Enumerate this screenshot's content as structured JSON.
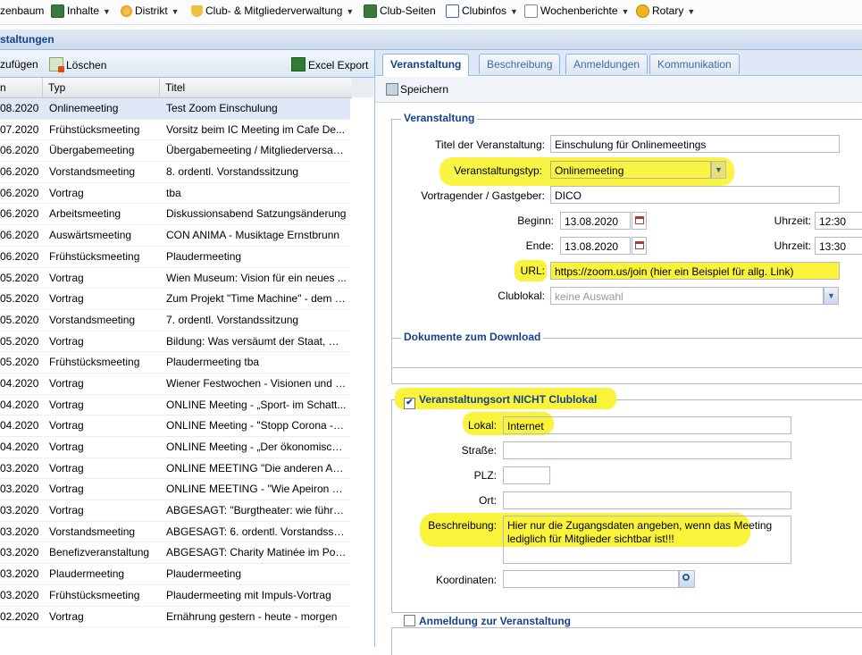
{
  "menubar": {
    "items": [
      {
        "label": "zenbaum",
        "icon": "",
        "has_arrow": false
      },
      {
        "label": "Inhalte",
        "icon": "table-icon",
        "has_arrow": true
      },
      {
        "label": "Distrikt",
        "icon": "flower-icon",
        "has_arrow": true
      },
      {
        "label": "Club- & Mitgliederverwaltung",
        "icon": "shield-icon",
        "has_arrow": true
      },
      {
        "label": "Club-Seiten",
        "icon": "table-icon",
        "has_arrow": false
      },
      {
        "label": "Clubinfos",
        "icon": "table-icon",
        "has_arrow": true
      },
      {
        "label": "Wochenberichte",
        "icon": "document-icon",
        "has_arrow": true
      },
      {
        "label": "Rotary",
        "icon": "rotary-wheel-icon",
        "has_arrow": true
      }
    ]
  },
  "panel_title": "staltungen",
  "list": {
    "toolbar": {
      "add": "zufügen",
      "delete": "Löschen",
      "export": "Excel Export"
    },
    "columns": [
      "n",
      "Typ",
      "Titel"
    ],
    "rows": [
      {
        "date": "08.2020",
        "type": "Onlinemeeting",
        "title": "Test Zoom Einschulung",
        "selected": true
      },
      {
        "date": "07.2020",
        "type": "Frühstücksmeeting",
        "title": "Vorsitz beim IC Meeting im Cafe De..."
      },
      {
        "date": "06.2020",
        "type": "Übergabemeeting",
        "title": "Übergabemeeting / Mitgliederversam..."
      },
      {
        "date": "06.2020",
        "type": "Vorstandsmeeting",
        "title": "8. ordentl. Vorstandssitzung"
      },
      {
        "date": "06.2020",
        "type": "Vortrag",
        "title": "tba"
      },
      {
        "date": "06.2020",
        "type": "Arbeitsmeeting",
        "title": "Diskussionsabend Satzungsänderung"
      },
      {
        "date": "06.2020",
        "type": "Auswärtsmeeting",
        "title": "CON ANIMA - Musiktage Ernstbrunn"
      },
      {
        "date": "06.2020",
        "type": "Frühstücksmeeting",
        "title": "Plaudermeeting"
      },
      {
        "date": "05.2020",
        "type": "Vortrag",
        "title": "Wien Museum: Vision für ein neues ..."
      },
      {
        "date": "05.2020",
        "type": "Vortrag",
        "title": "Zum Projekt \"Time Machine\" - dem g..."
      },
      {
        "date": "05.2020",
        "type": "Vorstandsmeeting",
        "title": "7. ordentl. Vorstandssitzung"
      },
      {
        "date": "05.2020",
        "type": "Vortrag",
        "title": "Bildung: Was versäumt der Staat, wa..."
      },
      {
        "date": "05.2020",
        "type": "Frühstücksmeeting",
        "title": "Plaudermeeting tba"
      },
      {
        "date": "04.2020",
        "type": "Vortrag",
        "title": "Wiener Festwochen - Visionen und I..."
      },
      {
        "date": "04.2020",
        "type": "Vortrag",
        "title": "ONLINE Meeting - „Sport- im Schatt..."
      },
      {
        "date": "04.2020",
        "type": "Vortrag",
        "title": "ONLINE Meeting - \"Stopp Corona - d..."
      },
      {
        "date": "04.2020",
        "type": "Vortrag",
        "title": "ONLINE Meeting - „Der ökonomisch..."
      },
      {
        "date": "03.2020",
        "type": "Vortrag",
        "title": "ONLINE MEETING \"Die anderen Au..."
      },
      {
        "date": "03.2020",
        "type": "Vortrag",
        "title": "ONLINE MEETING - \"Wie Apeiron Bi..."
      },
      {
        "date": "03.2020",
        "type": "Vortrag",
        "title": "ABGESAGT: \"Burgtheater: wie führt ..."
      },
      {
        "date": "03.2020",
        "type": "Vorstandsmeeting",
        "title": "ABGESAGT: 6. ordentl. Vorstandssit..."
      },
      {
        "date": "03.2020",
        "type": "Benefizveranstaltung",
        "title": "ABGESAGT: Charity Matinée im Por..."
      },
      {
        "date": "03.2020",
        "type": "Plaudermeeting",
        "title": "Plaudermeeting"
      },
      {
        "date": "03.2020",
        "type": "Frühstücksmeeting",
        "title": "Plaudermeeting mit Impuls-Vortrag"
      },
      {
        "date": "02.2020",
        "type": "Vortrag",
        "title": "Ernährung gestern - heute - morgen"
      }
    ]
  },
  "detail": {
    "tabs": [
      "Veranstaltung",
      "Beschreibung",
      "Anmeldungen",
      "Kommunikation"
    ],
    "save": "Speichern",
    "event": {
      "legend": "Veranstaltung",
      "title_label": "Titel der Veranstaltung:",
      "title_value": "Einschulung für Onlinemeetings",
      "type_label": "Veranstaltungstyp:",
      "type_value": "Onlinemeeting",
      "speaker_label": "Vortragender / Gastgeber:",
      "speaker_value": "DICO",
      "start_label": "Beginn:",
      "start_date": "13.08.2020",
      "start_time_label": "Uhrzeit:",
      "start_time": "12:30",
      "end_label": "Ende:",
      "end_date": "13.08.2020",
      "end_time_label": "Uhrzeit:",
      "end_time": "13:30",
      "url_label": "URL:",
      "url_value": "https://zoom.us/join (hier ein Beispiel für allg. Link)",
      "venue_label": "Clublokal:",
      "venue_placeholder": "keine Auswahl"
    },
    "docs": {
      "legend": "Dokumente zum Download"
    },
    "location": {
      "legend": "Veranstaltungsort NICHT Clublokal",
      "checked": true,
      "lokal_label": "Lokal:",
      "lokal_value": "Internet",
      "street_label": "Straße:",
      "plz_label": "PLZ:",
      "ort_label": "Ort:",
      "desc_label": "Beschreibung:",
      "desc_value": "Hier nur die Zugangsdaten angeben, wenn das Meeting lediglich für Mitglieder sichtbar ist!!!",
      "coords_label": "Koordinaten:"
    },
    "registration": {
      "legend": "Anmeldung zur Veranstaltung",
      "checked": false
    }
  },
  "colors": {
    "highlight": "#faf33b",
    "header_blue": "#15428b",
    "border_blue": "#99bbe8"
  }
}
